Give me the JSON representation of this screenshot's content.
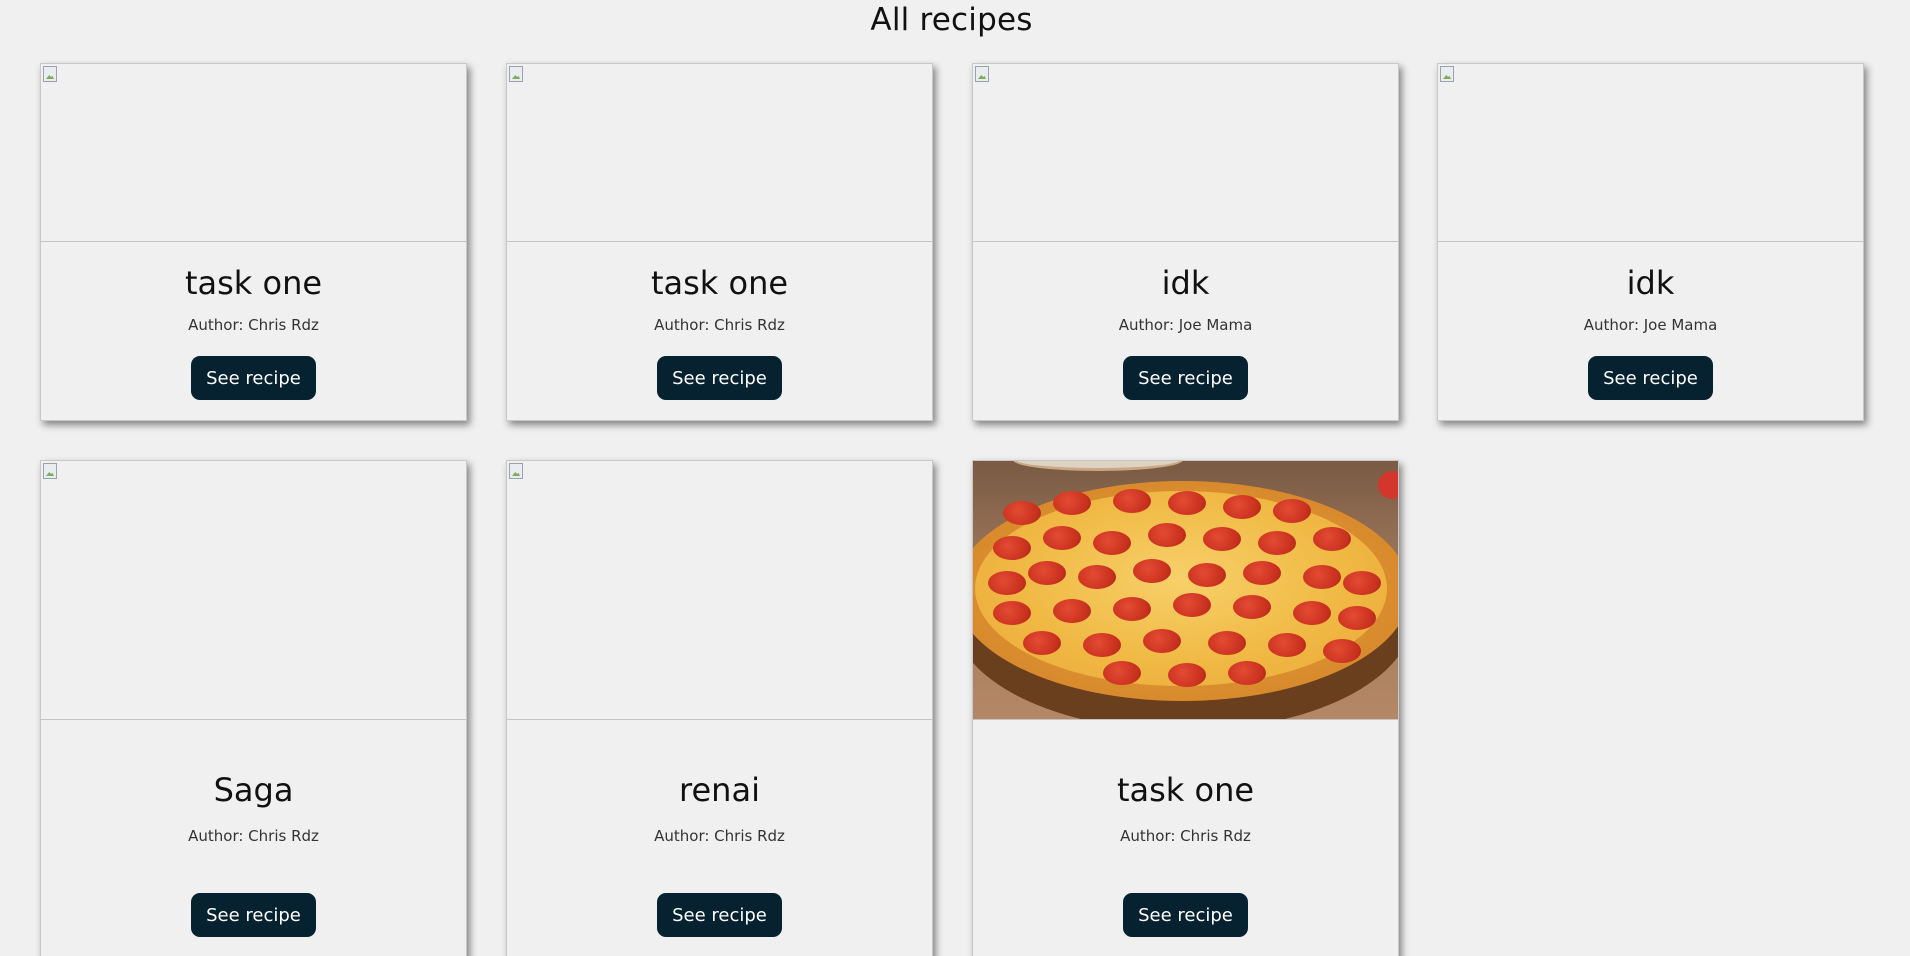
{
  "page": {
    "title": "All recipes"
  },
  "recipes": [
    {
      "title": "task one",
      "author": "Author: Chris Rdz",
      "button": "See recipe",
      "image": "broken-image-icon"
    },
    {
      "title": "task one",
      "author": "Author: Chris Rdz",
      "button": "See recipe",
      "image": "broken-image-icon"
    },
    {
      "title": "idk",
      "author": "Author: Joe Mama",
      "button": "See recipe",
      "image": "broken-image-icon"
    },
    {
      "title": "idk",
      "author": "Author: Joe Mama",
      "button": "See recipe",
      "image": "broken-image-icon"
    },
    {
      "title": "Saga",
      "author": "Author: Chris Rdz",
      "button": "See recipe",
      "image": "broken-image-icon"
    },
    {
      "title": "renai",
      "author": "Author: Chris Rdz",
      "button": "See recipe",
      "image": "broken-image-icon"
    },
    {
      "title": "task one",
      "author": "Author: Chris Rdz",
      "button": "See recipe",
      "image": "pepperoni-pizza-photo"
    }
  ],
  "colors": {
    "background": "#f0f0f0",
    "button": "#062231",
    "button_text": "#ffffff"
  }
}
